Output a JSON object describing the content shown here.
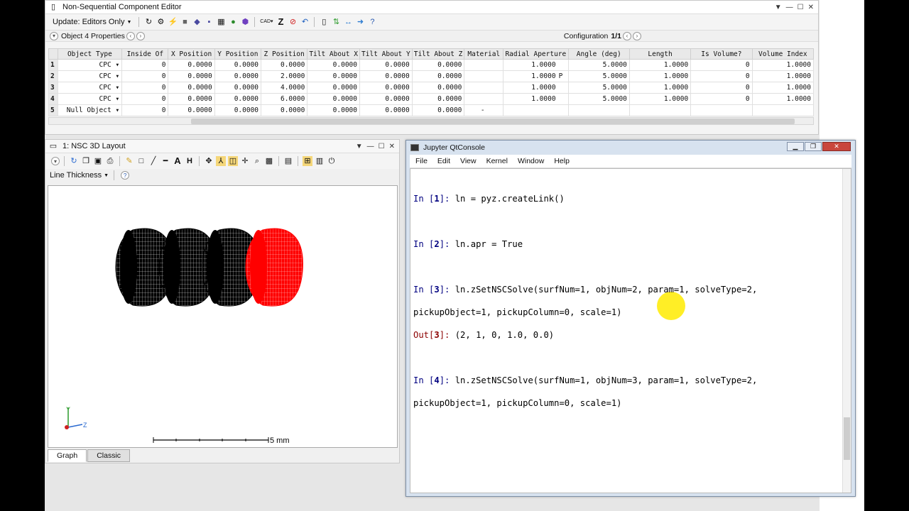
{
  "editor": {
    "title": "Non-Sequential Component Editor",
    "update_label": "Update: Editors Only",
    "object_props_label": "Object 4 Properties",
    "config_label": "Configuration",
    "config_value": "1/1",
    "columns": [
      "Object Type",
      "Inside Of",
      "X Position",
      "Y Position",
      "Z Position",
      "Tilt About X",
      "Tilt About Y",
      "Tilt About Z",
      "Material",
      "Radial Aperture",
      "Angle (deg)",
      "Length",
      "Is Volume?",
      "Volume Index"
    ],
    "rows": [
      {
        "n": "1",
        "type": "CPC",
        "inside": "0",
        "x": "0.0000",
        "y": "0.0000",
        "z": "0.0000",
        "tx": "0.0000",
        "ty": "0.0000",
        "tz": "0.0000",
        "mat": "",
        "rad": "1.0000",
        "solve": "",
        "ang": "5.0000",
        "len": "1.0000",
        "vol": "0",
        "vidx": "1.0000"
      },
      {
        "n": "2",
        "type": "CPC",
        "inside": "0",
        "x": "0.0000",
        "y": "0.0000",
        "z": "2.0000",
        "tx": "0.0000",
        "ty": "0.0000",
        "tz": "0.0000",
        "mat": "",
        "rad": "1.0000",
        "solve": "P",
        "ang": "5.0000",
        "len": "1.0000",
        "vol": "0",
        "vidx": "1.0000"
      },
      {
        "n": "3",
        "type": "CPC",
        "inside": "0",
        "x": "0.0000",
        "y": "0.0000",
        "z": "4.0000",
        "tx": "0.0000",
        "ty": "0.0000",
        "tz": "0.0000",
        "mat": "",
        "rad": "1.0000",
        "solve": "",
        "ang": "5.0000",
        "len": "1.0000",
        "vol": "0",
        "vidx": "1.0000"
      },
      {
        "n": "4",
        "type": "CPC",
        "inside": "0",
        "x": "0.0000",
        "y": "0.0000",
        "z": "6.0000",
        "tx": "0.0000",
        "ty": "0.0000",
        "tz": "0.0000",
        "mat": "",
        "rad": "1.0000",
        "solve": "",
        "ang": "5.0000",
        "len": "1.0000",
        "vol": "0",
        "vidx": "1.0000"
      },
      {
        "n": "5",
        "type": "Null Object",
        "inside": "0",
        "x": "0.0000",
        "y": "0.0000",
        "z": "0.0000",
        "tx": "0.0000",
        "ty": "0.0000",
        "tz": "0.0000",
        "mat": "-",
        "rad": "",
        "solve": "",
        "ang": "",
        "len": "",
        "vol": "",
        "vidx": ""
      }
    ]
  },
  "layout": {
    "title": "1: NSC 3D Layout",
    "line_thickness_label": "Line Thickness",
    "scale_label": "5 mm",
    "axis_y": "Y",
    "axis_z": "Z",
    "tabs": [
      "Graph",
      "Classic"
    ],
    "colors": {
      "black_cpc": "#000000",
      "red_cpc": "#ff0000"
    }
  },
  "jupyter": {
    "title": "Jupyter QtConsole",
    "menu": [
      "File",
      "Edit",
      "View",
      "Kernel",
      "Window",
      "Help"
    ],
    "cells": [
      {
        "n": "1",
        "code": "ln = pyz.createLink()"
      },
      {
        "n": "2",
        "code": "ln.apr = True"
      },
      {
        "n": "3",
        "code": "ln.zSetNSCSolve(surfNum=1, objNum=2, param=1, solveType=2,",
        "cont": "pickupObject=1, pickupColumn=0, scale=1)",
        "out": "(2, 1, 0, 1.0, 0.0)"
      },
      {
        "n": "4",
        "code": "ln.zSetNSCSolve(surfNum=1, objNum=3, param=1, solveType=2,",
        "cont": "pickupObject=1, pickupColumn=0, scale=1)"
      }
    ]
  }
}
